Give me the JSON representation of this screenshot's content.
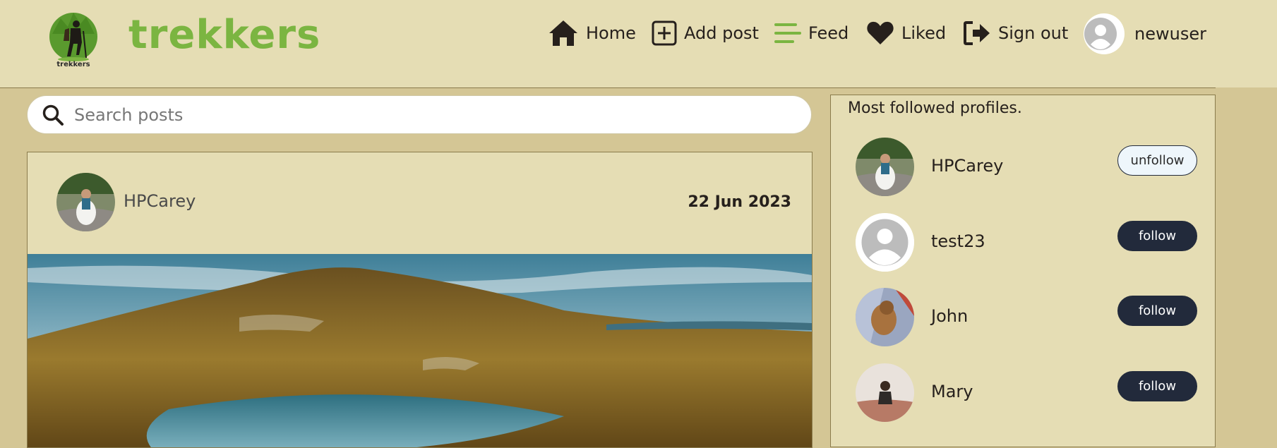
{
  "brand": {
    "name": "trekkers",
    "logo_caption": "trekkers"
  },
  "nav": {
    "items": [
      {
        "label": "Home",
        "icon": "home-icon"
      },
      {
        "label": "Add post",
        "icon": "add-post-icon"
      },
      {
        "label": "Feed",
        "icon": "feed-icon"
      },
      {
        "label": "Liked",
        "icon": "heart-icon"
      },
      {
        "label": "Sign out",
        "icon": "sign-out-icon"
      }
    ],
    "user": {
      "name": "newuser",
      "icon": "avatar-icon"
    }
  },
  "search": {
    "placeholder": "Search posts",
    "value": ""
  },
  "post": {
    "author": "HPCarey",
    "date": "22 Jun 2023"
  },
  "sidebar": {
    "title": "Most followed profiles.",
    "profiles": [
      {
        "name": "HPCarey",
        "button": "unfollow"
      },
      {
        "name": "test23",
        "button": "follow"
      },
      {
        "name": "John",
        "button": "follow"
      },
      {
        "name": "Mary",
        "button": "follow"
      }
    ]
  },
  "colors": {
    "accent": "#7bb541",
    "navbar_bg": "#e5ddb4",
    "page_bg": "#d4c695",
    "button_dark": "#222a3b"
  }
}
